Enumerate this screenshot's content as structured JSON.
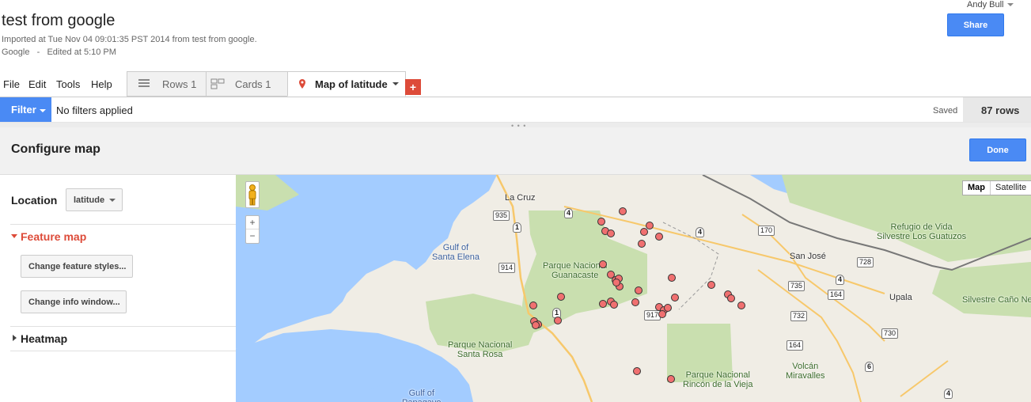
{
  "header": {
    "title": "test from google",
    "imported": "Imported at Tue Nov 04 09:01:35 PST 2014 from test from google.",
    "meta": "Google   -   Edited at 5:10 PM",
    "user": "Andy Bull",
    "share_label": "Share"
  },
  "menu": [
    "File",
    "Edit",
    "Tools",
    "Help"
  ],
  "tabs": [
    {
      "label": "Rows 1",
      "icon": "rows-icon"
    },
    {
      "label": "Cards 1",
      "icon": "cards-icon"
    },
    {
      "label": "Map of latitude",
      "icon": "map-pin-icon",
      "active": true
    }
  ],
  "add_tab_label": "+",
  "filter": {
    "button_label": "Filter",
    "status": "No filters applied",
    "saved": "Saved",
    "rows": "87 rows"
  },
  "configure": {
    "title": "Configure map",
    "done_label": "Done"
  },
  "sidebar": {
    "location_label": "Location",
    "location_value": "latitude",
    "feature_map_label": "Feature map",
    "change_styles_label": "Change feature styles...",
    "change_info_label": "Change info window...",
    "heatmap_label": "Heatmap"
  },
  "map": {
    "map_type_map": "Map",
    "map_type_satellite": "Satellite",
    "zoom_in": "+",
    "zoom_out": "−",
    "places": [
      {
        "label": "La Cruz",
        "kind": "town"
      },
      {
        "label": "Gulf of\nSanta Elena",
        "kind": "water"
      },
      {
        "label": "Parque Nacional\nGuanacaste",
        "kind": "park"
      },
      {
        "label": "Parque Nacional\nSanta Rosa",
        "kind": "park"
      },
      {
        "label": "Parque Nacional\nRincón de la Vieja",
        "kind": "park"
      },
      {
        "label": "Refugio de Vida\nSilvestre Los Guatuzos",
        "kind": "park"
      },
      {
        "label": "Silvestre Caño Ne",
        "kind": "park"
      },
      {
        "label": "San José",
        "kind": "town"
      },
      {
        "label": "Upala",
        "kind": "town"
      },
      {
        "label": "Volcán\nMiravalles",
        "kind": "park"
      },
      {
        "label": "Gulf of\nPapagayo",
        "kind": "water"
      }
    ],
    "shields": [
      "935",
      "4",
      "1",
      "914",
      "4",
      "170",
      "735",
      "728",
      "4",
      "164",
      "732",
      "917",
      "164",
      "730",
      "6",
      "4",
      "1"
    ],
    "colors": {
      "water": "#a3ccff",
      "land": "#f0ede5",
      "park": "#c9dfaf",
      "road": "#f7c86b",
      "pin": "#f07070"
    }
  }
}
